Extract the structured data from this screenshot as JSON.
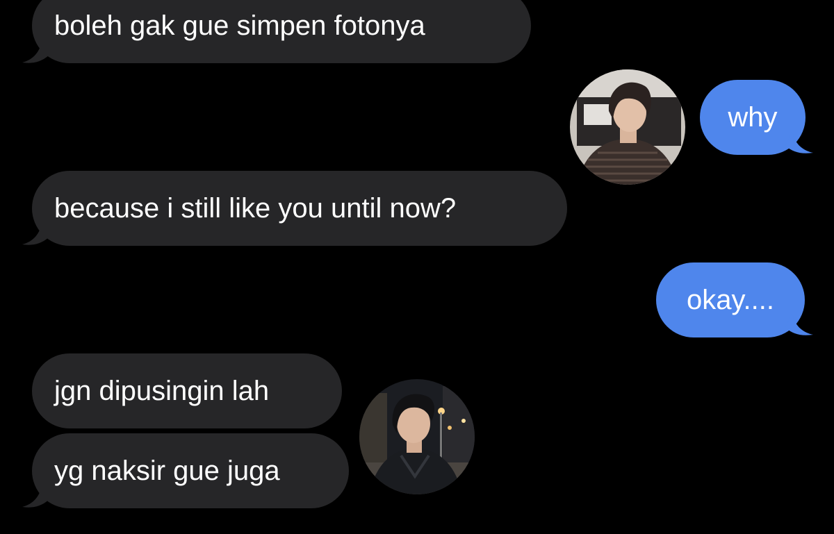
{
  "colors": {
    "background": "#000000",
    "received_bubble": "#262628",
    "sent_bubble": "#4f86ec",
    "text": "#ffffff"
  },
  "messages": [
    {
      "id": "m1",
      "direction": "received",
      "text": "boleh gak gue simpen fotonya"
    },
    {
      "id": "m2",
      "direction": "sent",
      "text": "why"
    },
    {
      "id": "m3",
      "direction": "received",
      "text": "because i still like you until now?"
    },
    {
      "id": "m4",
      "direction": "sent",
      "text": "okay...."
    },
    {
      "id": "m5",
      "direction": "received",
      "text": "jgn dipusingin lah"
    },
    {
      "id": "m6",
      "direction": "received",
      "text": "yg naksir gue juga"
    }
  ],
  "avatars": [
    {
      "id": "sender-photo",
      "icon": "person-photo-dark-hair-striped-sweater"
    },
    {
      "id": "receiver-photo",
      "icon": "person-photo-night-street"
    }
  ]
}
